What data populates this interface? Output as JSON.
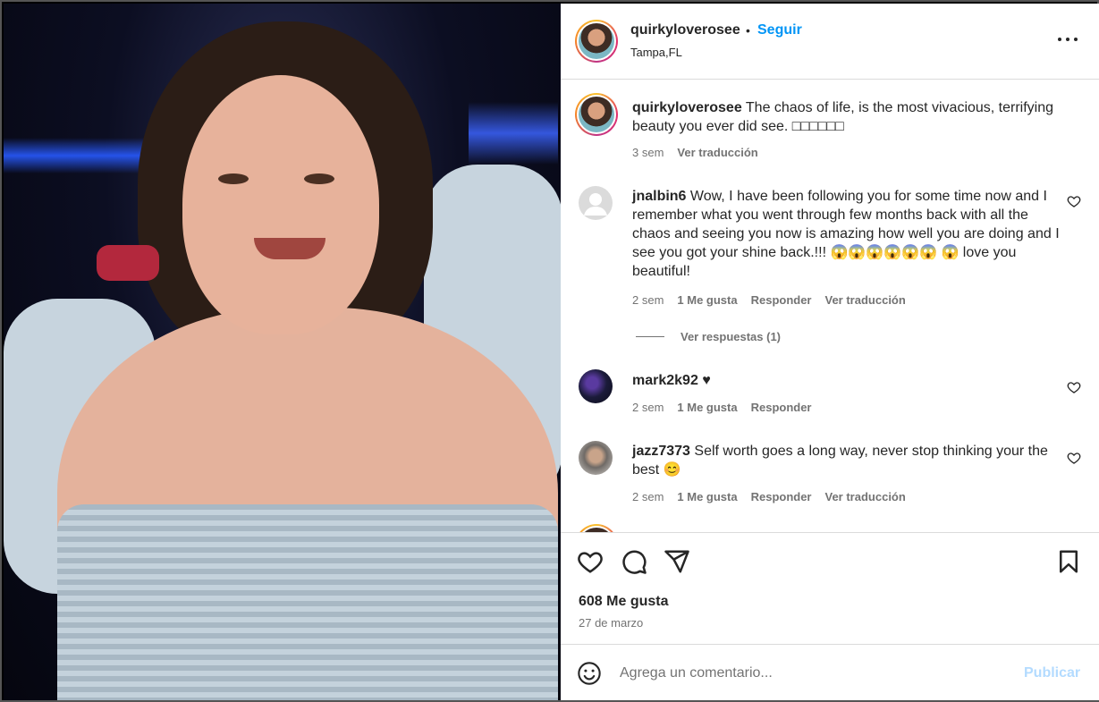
{
  "post": {
    "username": "quirkyloverosee",
    "separator": "•",
    "follow_label": "Seguir",
    "location": "Tampa,FL",
    "more_icon": "more-horizontal-icon"
  },
  "caption": {
    "username": "quirkyloverosee",
    "text": "The chaos of life, is the most vivacious, terrifying beauty you ever did see. □□□□□□",
    "time": "3 sem",
    "translate": "Ver traducción"
  },
  "comments": [
    {
      "username": "jnalbin6",
      "text": "Wow, I have been following you for some time now and I remember what you went through few months back with all the chaos and seeing you now is amazing how well you are doing and I see you got your shine back.!!! 😱😱😱😱😱😱 😱 love you beautiful!",
      "time": "2 sem",
      "likes": "1 Me gusta",
      "reply": "Responder",
      "translate": "Ver traducción",
      "view_replies": "Ver respuestas (1)"
    },
    {
      "username": "mark2k92",
      "text": "♥",
      "time": "2 sem",
      "likes": "1 Me gusta",
      "reply": "Responder"
    },
    {
      "username": "jazz7373",
      "text": "Self worth goes a long way, never stop thinking your the best 😊",
      "time": "2 sem",
      "likes": "1 Me gusta",
      "reply": "Responder",
      "translate": "Ver traducción"
    }
  ],
  "actions": {
    "like_icon": "heart-icon",
    "comment_icon": "comment-icon",
    "share_icon": "send-icon",
    "save_icon": "bookmark-icon",
    "likes_count": "608 Me gusta",
    "date": "27 de marzo"
  },
  "add_comment": {
    "placeholder": "Agrega un comentario...",
    "publish": "Publicar",
    "emoji_icon": "emoji-icon"
  },
  "colors": {
    "accent": "#0095f6",
    "publish_disabled": "#b3dbff",
    "text": "#262626",
    "muted": "#737373"
  }
}
